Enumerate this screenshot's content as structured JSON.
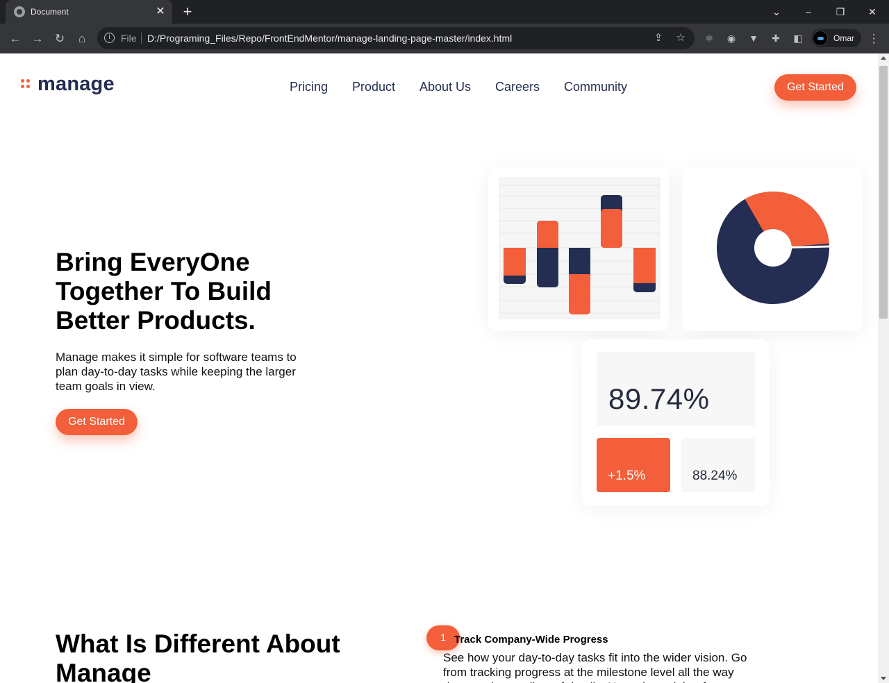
{
  "browser": {
    "tab_title": "Document",
    "tab_close": "✕",
    "new_tab": "+",
    "scheme": "File",
    "url": "D:/Programing_Files/Repo/FrontEndMentor/manage-landing-page-master/index.html",
    "profile_name": "Omar"
  },
  "page": {
    "logo_text": "manage",
    "nav": [
      "Pricing",
      "Product",
      "About Us",
      "Careers",
      "Community"
    ],
    "header_cta": "Get Started",
    "hero": {
      "title": "Bring EveryOne Together To Build Better Products.",
      "subtitle": "Manage makes it simple for software teams to plan day-to-day tasks while keeping the larger team goals in view.",
      "cta": "Get Started"
    },
    "stats": {
      "main": "89.74%",
      "delta": "+1.5%",
      "secondary": "88.24%"
    },
    "section": {
      "title": "What Is Different About Manage",
      "feature_number": "1",
      "feature_title": "Track Company-Wide Progress",
      "feature_text": "See how your day-to-day tasks fit into the wider vision. Go from tracking progress at the milestone level all the way down to the smallest of details. Never lose sight of"
    },
    "colors": {
      "accent": "#f25f3a",
      "navy": "#242d52"
    }
  }
}
